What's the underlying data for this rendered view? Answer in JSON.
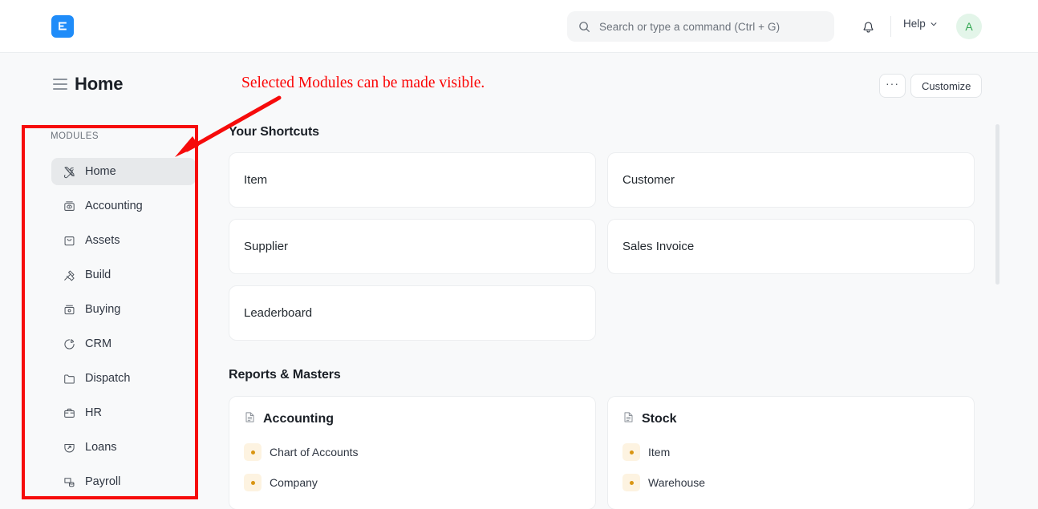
{
  "navbar": {
    "logo_icon": "erpnext-logo-icon",
    "search": {
      "placeholder": "Search or type a command (Ctrl + G)",
      "value": "",
      "icon": "search-icon"
    },
    "notifications_icon": "bell-icon",
    "help_label": "Help",
    "help_chevron_icon": "chevron-down-icon",
    "avatar_initial": "A",
    "avatar_bg": "#e3f5e9",
    "avatar_fg": "#34a853"
  },
  "page_head": {
    "menu_icon": "hamburger-menu-icon",
    "title": "Home",
    "ellipsis_label": "···",
    "customize_label": "Customize"
  },
  "annotation": {
    "text": "Selected Modules can be made visible.",
    "color": "#fb0505",
    "box_color": "#f60b0b"
  },
  "sidebar": {
    "section_label": "MODULES",
    "items": [
      {
        "label": "Home",
        "icon": "tools-icon",
        "active": true
      },
      {
        "label": "Accounting",
        "icon": "ledger-eye-icon",
        "active": false
      },
      {
        "label": "Assets",
        "icon": "shopping-bag-icon",
        "active": false
      },
      {
        "label": "Build",
        "icon": "hammer-icon",
        "active": false
      },
      {
        "label": "Buying",
        "icon": "cart-box-icon",
        "active": false
      },
      {
        "label": "CRM",
        "icon": "pie-chart-icon",
        "active": false
      },
      {
        "label": "Dispatch",
        "icon": "folder-icon",
        "active": false
      },
      {
        "label": "HR",
        "icon": "briefcase-icon",
        "active": false
      },
      {
        "label": "Loans",
        "icon": "loan-icon",
        "active": false
      },
      {
        "label": "Payroll",
        "icon": "payroll-icon",
        "active": false
      }
    ]
  },
  "main": {
    "shortcuts": {
      "title": "Your Shortcuts",
      "cards": [
        {
          "label": "Item"
        },
        {
          "label": "Customer"
        },
        {
          "label": "Supplier"
        },
        {
          "label": "Sales Invoice"
        },
        {
          "label": "Leaderboard"
        }
      ]
    },
    "reports_masters": {
      "title": "Reports & Masters",
      "cards": [
        {
          "title": "Accounting",
          "icon": "document-icon",
          "links": [
            {
              "label": "Chart of Accounts"
            },
            {
              "label": "Company"
            }
          ]
        },
        {
          "title": "Stock",
          "icon": "document-icon",
          "links": [
            {
              "label": "Item"
            },
            {
              "label": "Warehouse"
            }
          ]
        }
      ]
    },
    "scrollbar": {
      "name": "vertical-scrollbar"
    }
  }
}
